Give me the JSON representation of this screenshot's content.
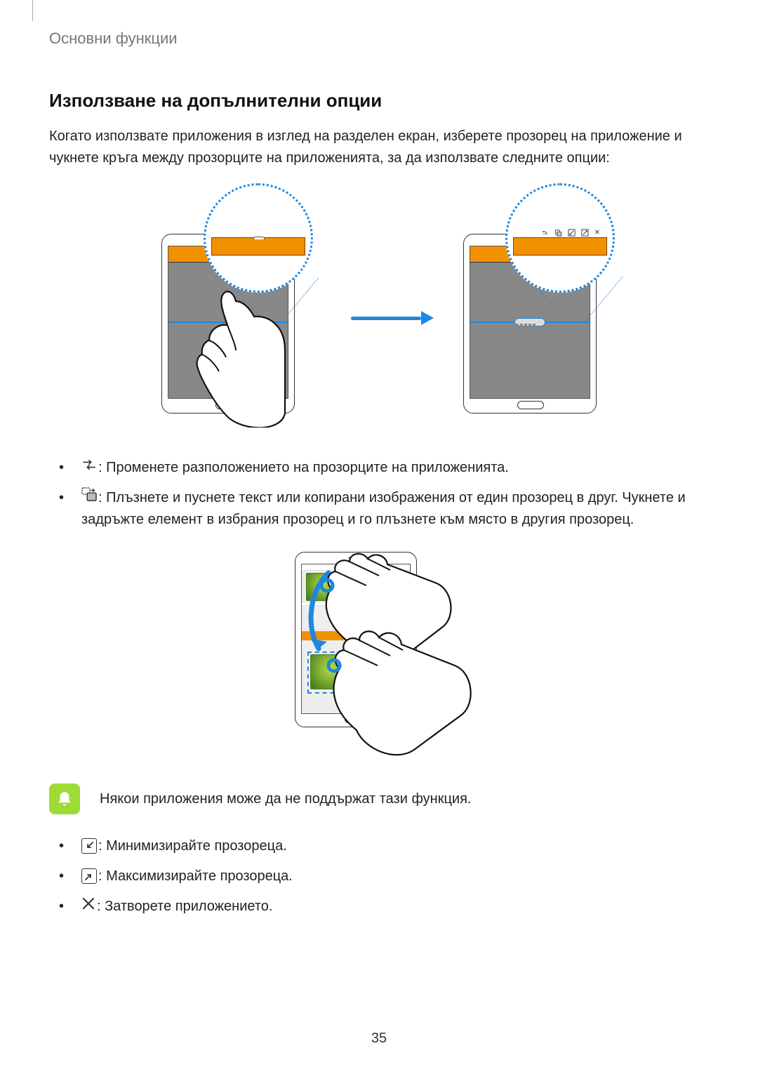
{
  "header": {
    "breadcrumb": "Основни функции"
  },
  "section": {
    "title": "Използване на допълнителни опции",
    "intro": "Когато използвате приложения в изглед на разделен екран, изберете прозорец на приложение и чукнете кръга между прозорците на приложенията, за да използвате следните опции:"
  },
  "bullets_top": [
    {
      "icon": "swap",
      "text": ": Променете разположението на прозорците на приложенията."
    },
    {
      "icon": "drag",
      "text": ": Плъзнете и пуснете текст или копирани изображения от един прозорец в друг. Чукнете и задръжте елемент в избрания прозорец и го плъзнете към място в другия прозорец."
    }
  ],
  "note": {
    "text": "Някои приложения може да не поддържат тази функция."
  },
  "bullets_bottom": [
    {
      "icon": "minimize",
      "text": ": Минимизирайте прозореца."
    },
    {
      "icon": "maximize",
      "text": ": Максимизирайте прозореца."
    },
    {
      "icon": "close",
      "text": ": Затворете приложението."
    }
  ],
  "page_number": "35"
}
